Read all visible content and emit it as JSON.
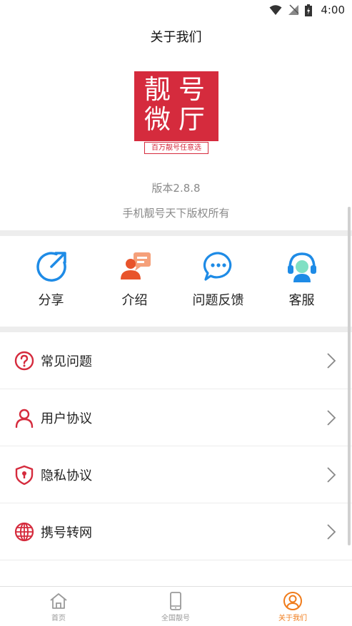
{
  "status_bar": {
    "time": "4:00"
  },
  "header": {
    "title": "关于我们"
  },
  "logo": {
    "chars": [
      "靓",
      "号",
      "微",
      "厅"
    ],
    "tagline": "百万靓号任意选"
  },
  "info": {
    "version": "版本2.8.8",
    "copyright": "手机靓号天下版权所有"
  },
  "actions": [
    {
      "label": "分享",
      "icon": "share-icon"
    },
    {
      "label": "介绍",
      "icon": "introduction-icon"
    },
    {
      "label": "问题反馈",
      "icon": "feedback-chat-icon"
    },
    {
      "label": "客服",
      "icon": "customer-service-icon"
    }
  ],
  "menu": [
    {
      "label": "常见问题",
      "icon": "question-icon"
    },
    {
      "label": "用户协议",
      "icon": "user-icon"
    },
    {
      "label": "隐私协议",
      "icon": "shield-icon"
    },
    {
      "label": "携号转网",
      "icon": "globe-icon"
    }
  ],
  "tabs": [
    {
      "label": "首页",
      "icon": "home-icon",
      "active": false
    },
    {
      "label": "全国靓号",
      "icon": "phone-icon",
      "active": false
    },
    {
      "label": "关于我们",
      "icon": "profile-icon",
      "active": true
    }
  ],
  "colors": {
    "accent": "#f07b1a",
    "brand_red": "#d52b3d",
    "action_blue": "#1e8be6",
    "menu_red": "#d52b3d"
  }
}
